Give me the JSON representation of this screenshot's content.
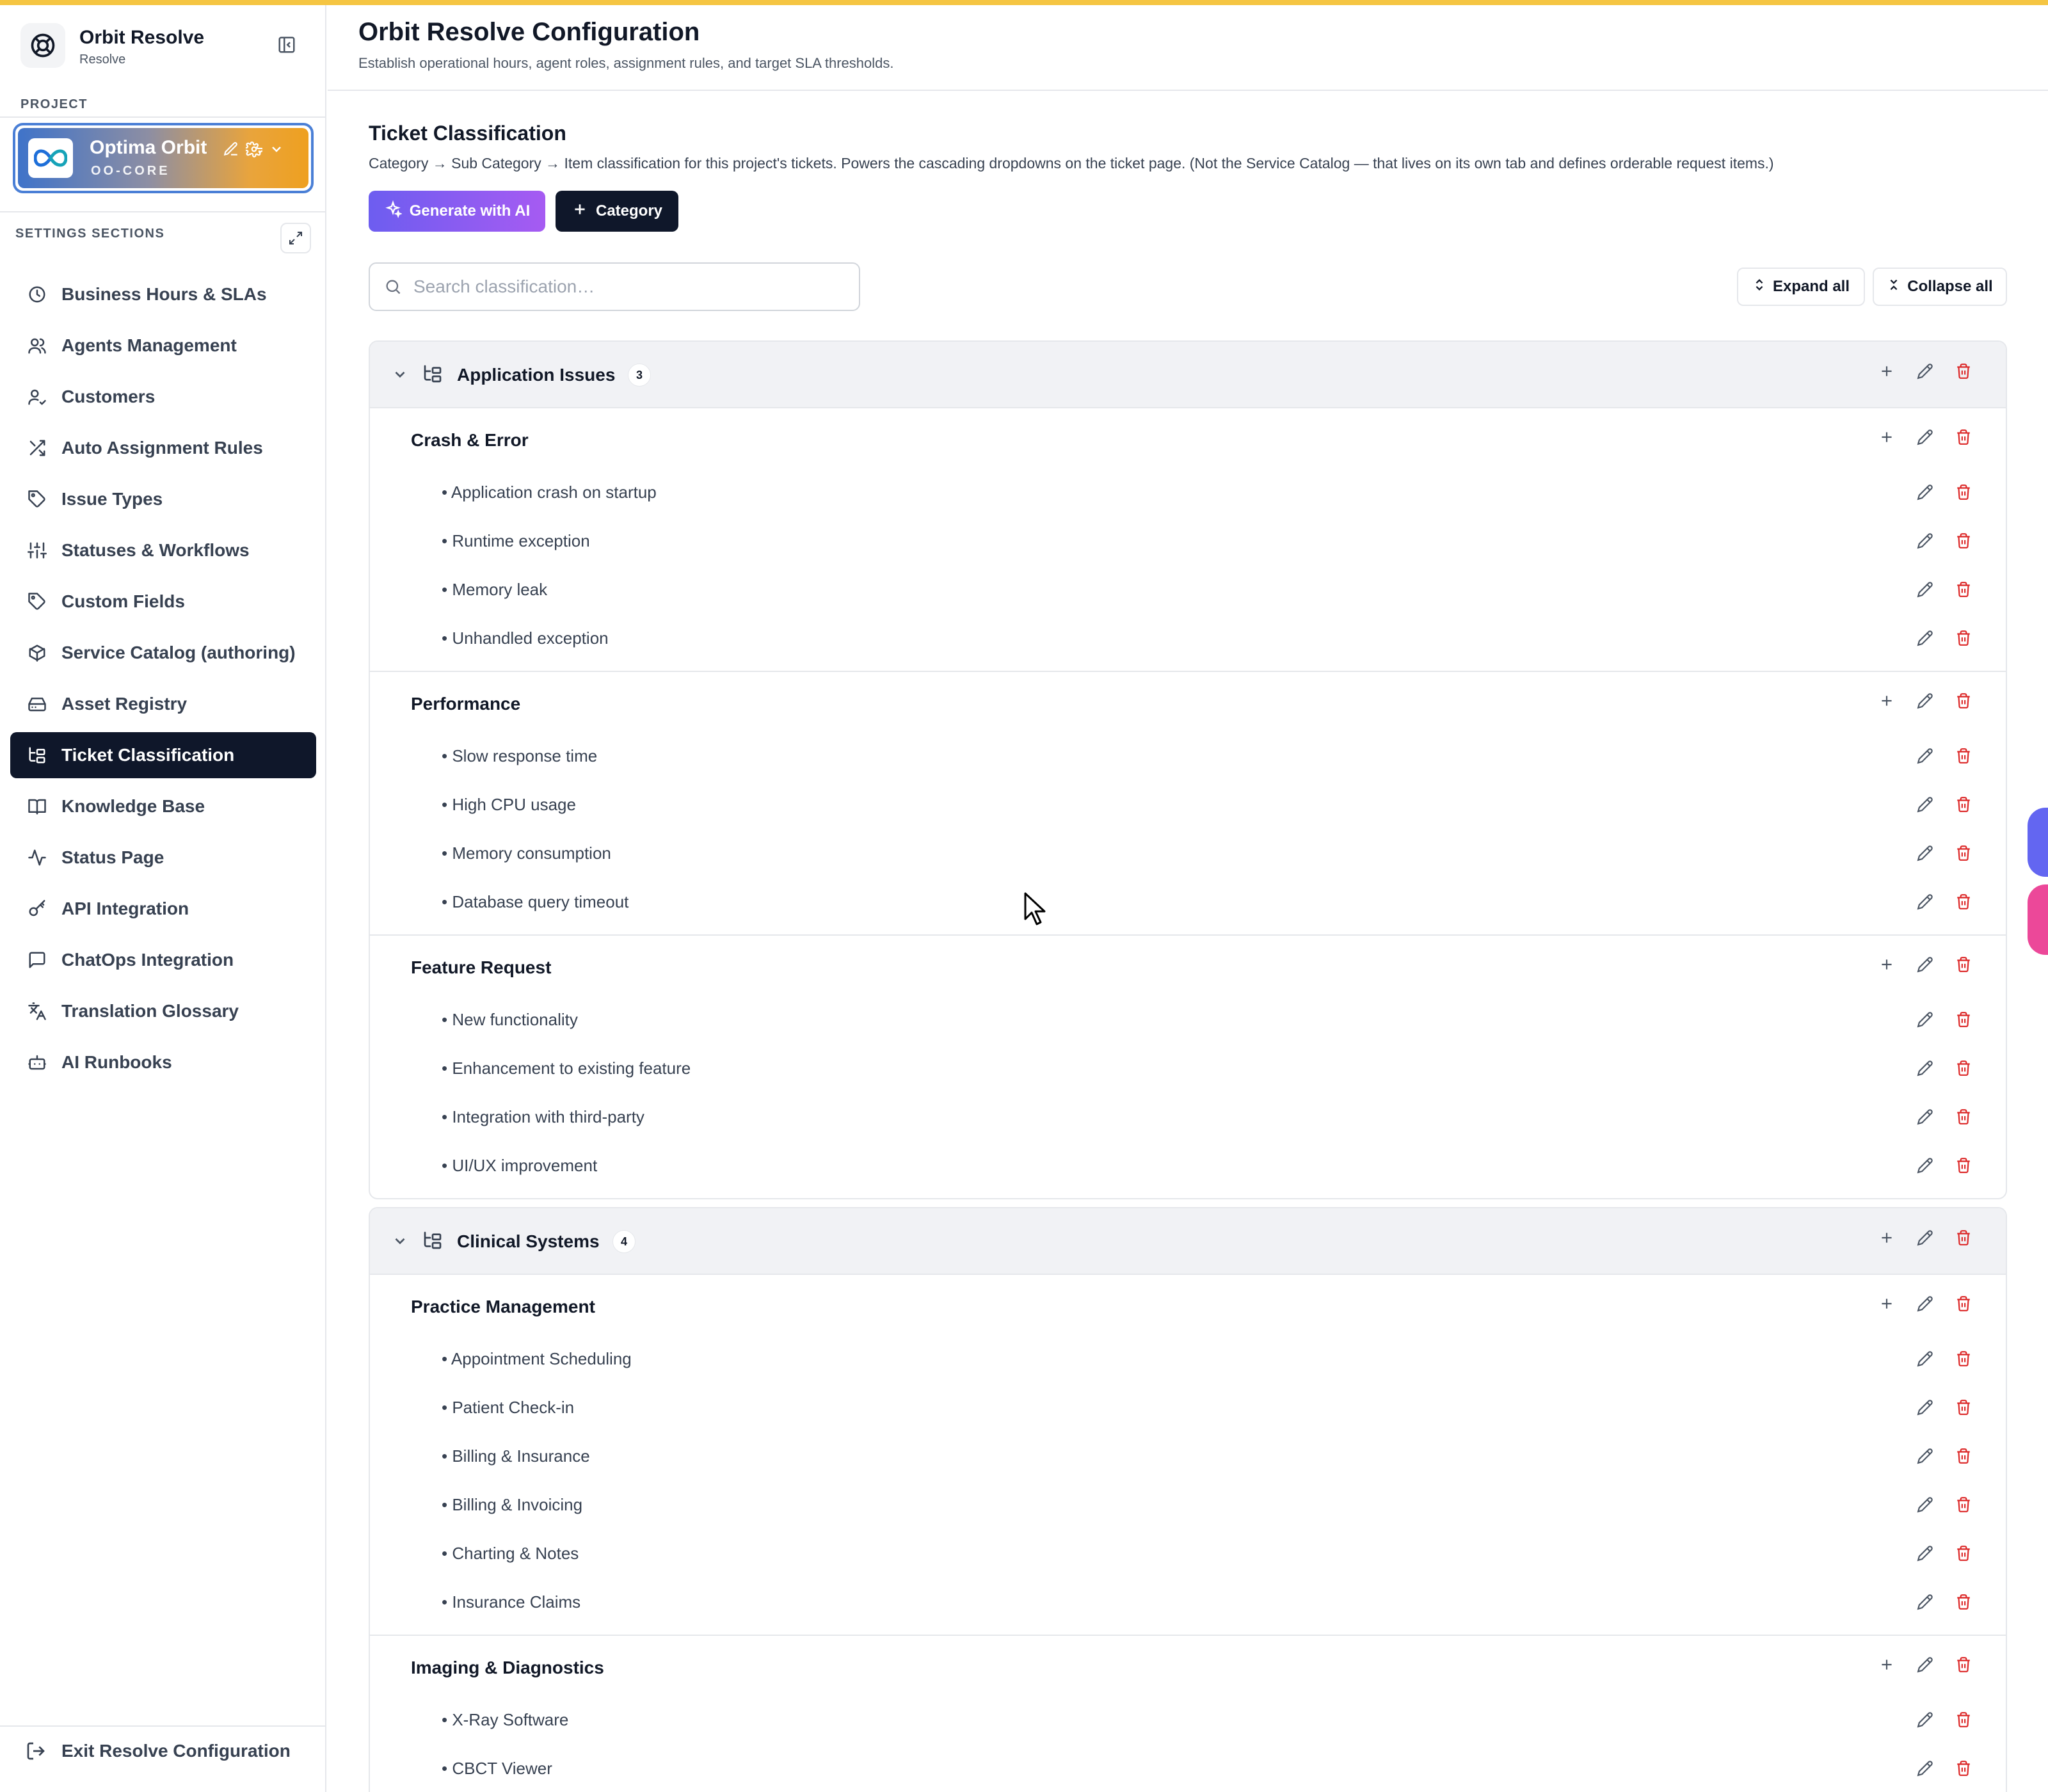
{
  "brand": {
    "title": "Orbit Resolve",
    "subtitle": "Resolve"
  },
  "project": {
    "label": "PROJECT",
    "name": "Optima Orbit",
    "code": "OO-CORE"
  },
  "sidebar": {
    "sections_label": "SETTINGS SECTIONS",
    "items": [
      {
        "label": "Business Hours & SLAs",
        "icon": "clock-icon"
      },
      {
        "label": "Agents Management",
        "icon": "users-icon"
      },
      {
        "label": "Customers",
        "icon": "user-check-icon"
      },
      {
        "label": "Auto Assignment Rules",
        "icon": "shuffle-icon"
      },
      {
        "label": "Issue Types",
        "icon": "tag-icon"
      },
      {
        "label": "Statuses & Workflows",
        "icon": "sliders-icon"
      },
      {
        "label": "Custom Fields",
        "icon": "tag-icon"
      },
      {
        "label": "Service Catalog (authoring)",
        "icon": "package-icon"
      },
      {
        "label": "Asset Registry",
        "icon": "hard-drive-icon"
      },
      {
        "label": "Ticket Classification",
        "icon": "folder-tree-icon",
        "active": true
      },
      {
        "label": "Knowledge Base",
        "icon": "book-icon"
      },
      {
        "label": "Status Page",
        "icon": "activity-icon"
      },
      {
        "label": "API Integration",
        "icon": "key-icon"
      },
      {
        "label": "ChatOps Integration",
        "icon": "message-square-icon"
      },
      {
        "label": "Translation Glossary",
        "icon": "languages-icon"
      },
      {
        "label": "AI Runbooks",
        "icon": "bot-icon"
      }
    ],
    "exit_label": "Exit Resolve Configuration"
  },
  "header": {
    "title": "Orbit Resolve Configuration",
    "subtitle": "Establish operational hours, agent roles, assignment rules, and target SLA thresholds."
  },
  "main": {
    "title": "Ticket Classification",
    "description": "Category → Sub Category → Item classification for this project's tickets. Powers the cascading dropdowns on the ticket page. (Not the Service Catalog — that lives on its own tab and defines orderable request items.)",
    "generate_label": "Generate with AI",
    "category_label": "Category",
    "search_placeholder": "Search classification…",
    "expand_label": "Expand all",
    "collapse_label": "Collapse all",
    "categories": [
      {
        "name": "Application Issues",
        "count": "3",
        "subcategories": [
          {
            "name": "Crash & Error",
            "items": [
              "• Application crash on startup",
              "• Runtime exception",
              "• Memory leak",
              "• Unhandled exception"
            ]
          },
          {
            "name": "Performance",
            "items": [
              "• Slow response time",
              "• High CPU usage",
              "• Memory consumption",
              "• Database query timeout"
            ]
          },
          {
            "name": "Feature Request",
            "items": [
              "• New functionality",
              "• Enhancement to existing feature",
              "• Integration with third-party",
              "• UI/UX improvement"
            ]
          }
        ]
      },
      {
        "name": "Clinical Systems",
        "count": "4",
        "subcategories": [
          {
            "name": "Practice Management",
            "items": [
              "• Appointment Scheduling",
              "• Patient Check-in",
              "• Billing & Insurance",
              "• Billing & Invoicing",
              "• Charting & Notes",
              "• Insurance Claims"
            ]
          },
          {
            "name": "Imaging & Diagnostics",
            "items": [
              "• X-Ray Software",
              "• CBCT Viewer"
            ]
          }
        ]
      }
    ]
  },
  "colors": {
    "accent_top": "#f5c542",
    "nav_active": "#0f172a",
    "delete": "#dc2626",
    "ai_gradient_start": "#6d5df0",
    "ai_gradient_end": "#a65bf2"
  }
}
